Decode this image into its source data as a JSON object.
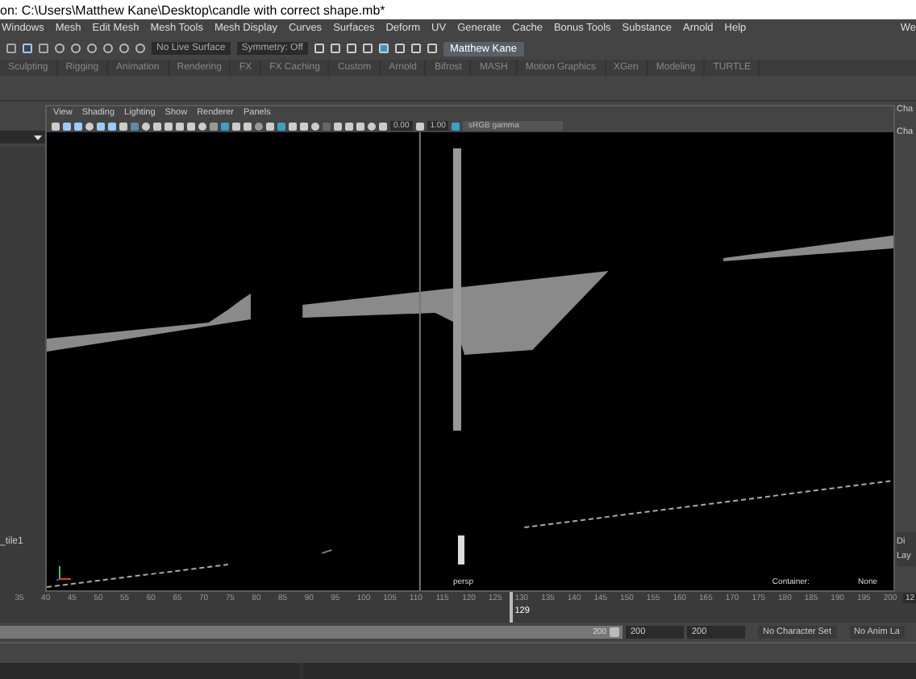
{
  "window": {
    "title": "on: C:\\Users\\Matthew Kane\\Desktop\\candle with correct shape.mb*"
  },
  "menu_bar": {
    "items": [
      "Windows",
      "Mesh",
      "Edit Mesh",
      "Mesh Tools",
      "Mesh Display",
      "Curves",
      "Surfaces",
      "Deform",
      "UV",
      "Generate",
      "Cache",
      "Bonus Tools",
      "Substance",
      "Arnold",
      "Help"
    ],
    "right_text": "We"
  },
  "status_line": {
    "live_surface": "No Live Surface",
    "symmetry": "Symmetry: Off",
    "user": "Matthew Kane"
  },
  "shelf_tabs": [
    {
      "label": "Sculpting",
      "selected": false
    },
    {
      "label": "Rigging",
      "selected": false
    },
    {
      "label": "Animation",
      "selected": false
    },
    {
      "label": "Rendering",
      "selected": false
    },
    {
      "label": "FX",
      "selected": false
    },
    {
      "label": "FX Caching",
      "selected": false
    },
    {
      "label": "Custom",
      "selected": false
    },
    {
      "label": "Arnold",
      "selected": false
    },
    {
      "label": "Bifrost",
      "selected": false
    },
    {
      "label": "MASH",
      "selected": false
    },
    {
      "label": "Motion Graphics",
      "selected": false
    },
    {
      "label": "XGen",
      "selected": false
    },
    {
      "label": "Modeling",
      "selected": false
    },
    {
      "label": "TURTLE",
      "selected": false
    }
  ],
  "outliner": {
    "item": "_tile1"
  },
  "viewport": {
    "menu": [
      "View",
      "Shading",
      "Lighting",
      "Show",
      "Renderer",
      "Panels"
    ],
    "exposure": "0.00",
    "gamma": "1.00",
    "color_space": "sRGB gamma",
    "camera": "persp",
    "container_label": "Container:",
    "container_value": "None"
  },
  "channel_box": {
    "labels": [
      "Cha",
      "Cha"
    ],
    "layer_tabs": [
      "Di",
      "Lay"
    ]
  },
  "time_slider": {
    "ticks": [
      "35",
      "40",
      "45",
      "50",
      "55",
      "60",
      "65",
      "70",
      "75",
      "80",
      "85",
      "90",
      "95",
      "100",
      "105",
      "110",
      "115",
      "120",
      "125",
      "130",
      "135",
      "140",
      "145",
      "150",
      "155",
      "160",
      "165",
      "170",
      "175",
      "180",
      "185",
      "190",
      "195",
      "200"
    ],
    "current_frame": "129",
    "level": 0.57,
    "end_field": "12"
  },
  "range_slider": {
    "level": 1,
    "end_value": "200",
    "playback_end": "200",
    "animation_end": "200",
    "character_set": "No Character Set",
    "anim_layer": "No Anim La"
  }
}
